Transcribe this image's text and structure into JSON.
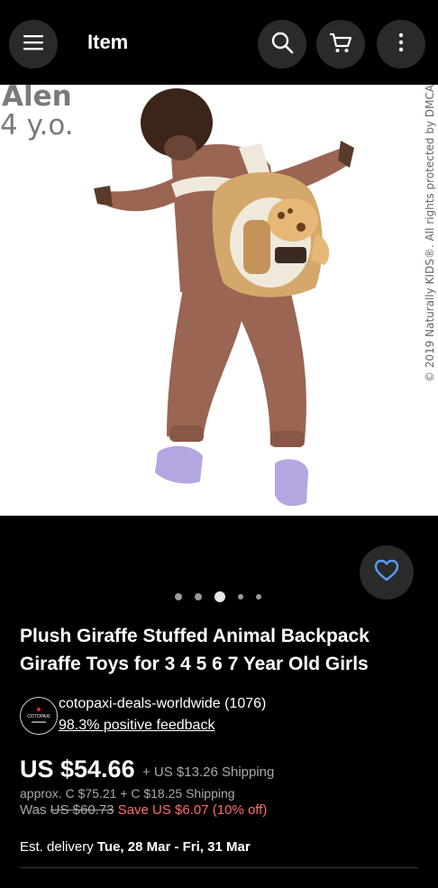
{
  "header": {
    "title": "Item",
    "menu_icon": "hamburger-menu-icon",
    "search_icon": "search-icon",
    "cart_icon": "cart-icon",
    "more_icon": "more-vertical-icon"
  },
  "hero": {
    "watermark_name": "Alen",
    "watermark_age": "4 y.o.",
    "copyright": "© 2019 Naturally KIDS®. All rights protected by DMCA."
  },
  "carousel": {
    "count": 5,
    "active_index": 2
  },
  "product": {
    "title": "Plush Giraffe Stuffed Animal Backpack Giraffe Toys for 3 4 5 6 7 Year Old Girls"
  },
  "seller": {
    "name": "cotopaxi-deals-worldwide (1076)",
    "feedback": "98.3% positive feedback",
    "avatar_text": "COTOPAXI"
  },
  "pricing": {
    "price": "US $54.66",
    "shipping": "+ US $13.26 Shipping",
    "approx": "approx. C $75.21  + C $18.25 Shipping",
    "was_label": "Was",
    "was_price": "US $60.73",
    "save": "Save US $6.07 (10% off)"
  },
  "delivery": {
    "label": "Est. delivery",
    "dates": "Tue, 28 Mar - Fri, 31 Mar"
  },
  "colors": {
    "background": "#000000",
    "save": "#ff6b6b",
    "accent": "#5b9cff"
  }
}
